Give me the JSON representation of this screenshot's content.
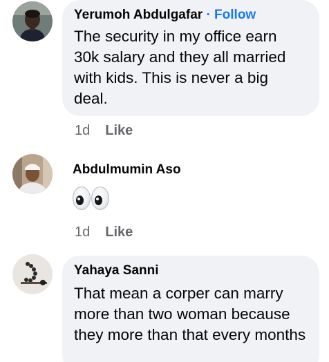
{
  "comments": [
    {
      "author": "Yerumoh Abdulgafar",
      "follow_separator": "·",
      "follow_label": "Follow",
      "text": "The security in my office earn 30k salary and they all married with kids. This is never a big deal.",
      "time": "1d",
      "like_label": "Like",
      "avatar_icon": "profile-photo-man-dark-shirt"
    },
    {
      "author": "Abdulmumin Aso",
      "text": "👀",
      "time": "1d",
      "like_label": "Like",
      "avatar_icon": "profile-photo-man-white-cap"
    },
    {
      "author": "Yahaya Sanni",
      "text": "That mean a corper can marry more than two woman because they more than that every months",
      "avatar_icon": "profile-photo-prayer-beads"
    }
  ],
  "colors": {
    "bubble": "#f0f2f5",
    "link": "#1877f2",
    "meta": "#65676b",
    "text": "#050505"
  }
}
